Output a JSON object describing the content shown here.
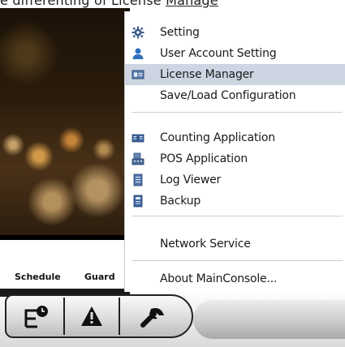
{
  "top_banner": {
    "text_prefix": "e differenting of License ",
    "text_link": "Manage"
  },
  "preview_tabs": {
    "schedule": "Schedule",
    "guard": "Guard"
  },
  "menu": {
    "items": [
      {
        "label": "Setting",
        "icon": "gear-icon"
      },
      {
        "label": "User Account Setting",
        "icon": "user-icon"
      },
      {
        "label": "License Manager",
        "icon": "license-card-icon"
      },
      {
        "label": "Save/Load Configuration",
        "icon": ""
      },
      {
        "label": "Counting Application",
        "icon": "book-icon"
      },
      {
        "label": "POS Application",
        "icon": "pos-terminal-icon"
      },
      {
        "label": "Log Viewer",
        "icon": "log-document-icon"
      },
      {
        "label": "Backup",
        "icon": "backup-icon"
      },
      {
        "label": "Network Service",
        "icon": ""
      },
      {
        "label": "About MainConsole...",
        "icon": ""
      }
    ],
    "active_index": 2,
    "highlight_color": "#cdd5e2"
  },
  "toolbar": {
    "buttons": [
      {
        "name": "schedule-tool-button",
        "icon": "schedule-clock-icon"
      },
      {
        "name": "guard-tool-button",
        "icon": "warning-icon"
      },
      {
        "name": "tools-button",
        "icon": "wrench-icon"
      }
    ]
  }
}
